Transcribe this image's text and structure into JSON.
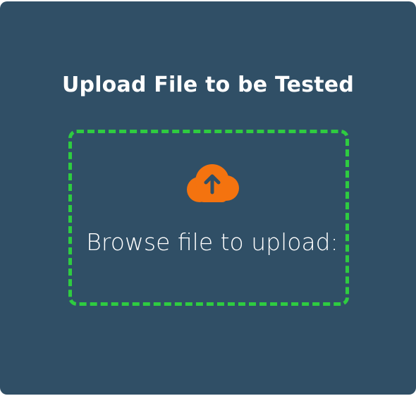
{
  "upload": {
    "title": "Upload File to be Tested",
    "browse_label": "Browse file to upload:",
    "icon": "cloud-upload-icon"
  },
  "colors": {
    "card_background": "#304f66",
    "dropzone_border": "#2ecc40",
    "icon_color": "#f4730f",
    "text": "#ffffff"
  }
}
